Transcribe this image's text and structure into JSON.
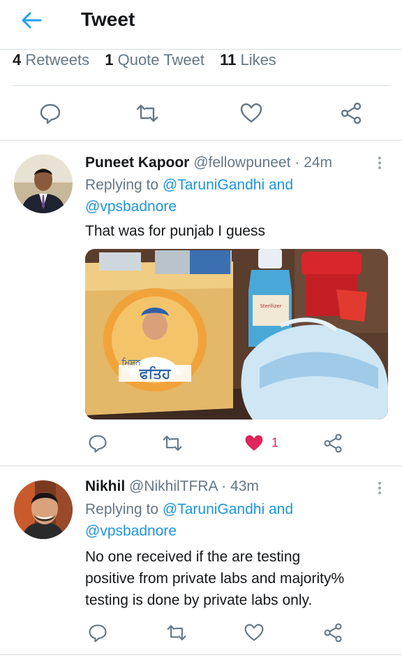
{
  "header": {
    "title": "Tweet",
    "back_icon": "back-arrow-icon",
    "accent": "#1da1f2"
  },
  "stats": [
    {
      "count": "4",
      "label": "Retweets"
    },
    {
      "count": "1",
      "label": "Quote Tweet"
    },
    {
      "count": "11",
      "label": "Likes"
    }
  ],
  "actions": {
    "reply_icon": "reply-icon",
    "retweet_icon": "retweet-icon",
    "like_icon": "heart-icon",
    "share_icon": "share-icon"
  },
  "replies": [
    {
      "name": "Puneet Kapoor",
      "handle": "@fellowpuneet",
      "separator": "·",
      "time": "24m",
      "replying_prefix": "Replying to",
      "replying_to": "@TaruniGandhi and @vpsbadnore",
      "reply_to_1": "@TaruniGandhi and",
      "reply_to_2": "@vpsbadnore",
      "text": "That was for punjab I guess",
      "media": {
        "box_label": "ਫਤਿਹ",
        "box_label_hindi": "ਮਿਸ਼ਨ",
        "bottle_label": "Sterilizer"
      },
      "like_count": "1",
      "liked": true,
      "like_color": "#e0245e"
    },
    {
      "name": "Nikhil",
      "handle": "@NikhilTFRA",
      "separator": "·",
      "time": "43m",
      "replying_prefix": "Replying to",
      "reply_to_1": "@TaruniGandhi and",
      "reply_to_2": "@vpsbadnore",
      "text_lines": [
        "No one received if the are testing",
        "positive from private labs and majority%",
        "testing is done by private labs only."
      ]
    }
  ]
}
